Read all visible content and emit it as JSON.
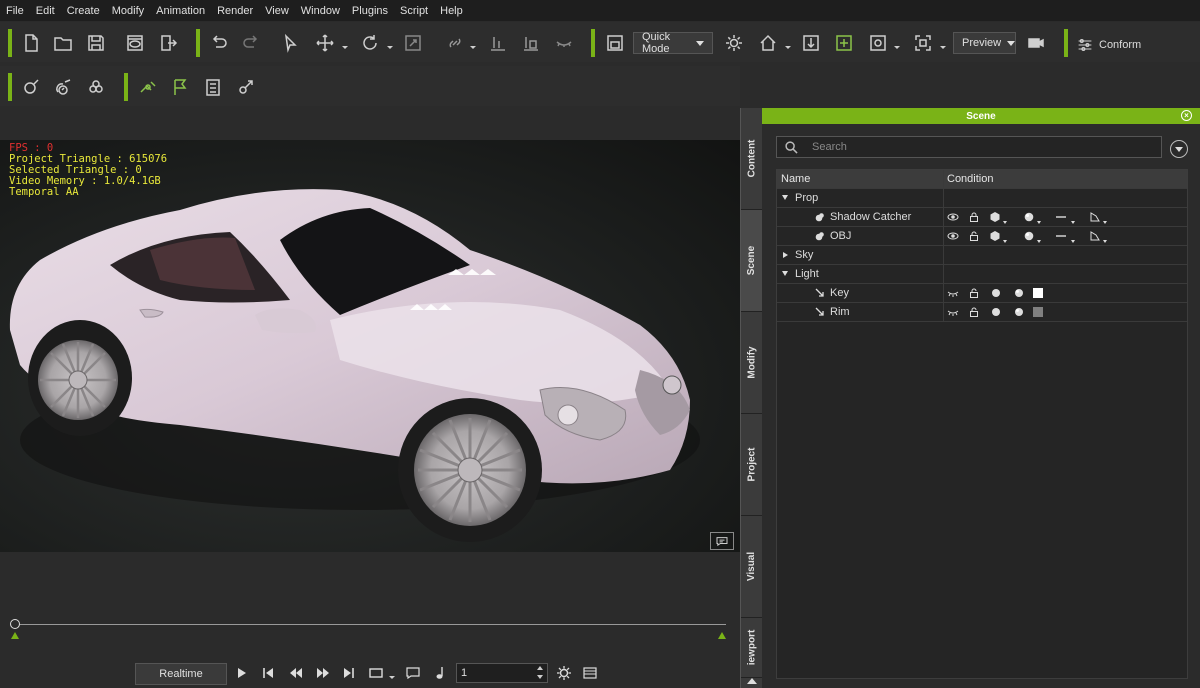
{
  "menu": [
    "File",
    "Edit",
    "Create",
    "Modify",
    "Animation",
    "Render",
    "View",
    "Window",
    "Plugins",
    "Script",
    "Help"
  ],
  "toolbar": {
    "quick_mode": "Quick Mode",
    "preview": "Preview",
    "conform": "Conform"
  },
  "hud": {
    "fps": "FPS : 0",
    "project_triangle": "Project Triangle : 615076",
    "selected_triangle": "Selected Triangle : 0",
    "video_memory": "Video Memory : 1.0/4.1GB",
    "temporal_aa": "Temporal AA"
  },
  "playback": {
    "mode": "Realtime",
    "frame": "1"
  },
  "side_tabs": [
    "Content",
    "Scene",
    "Modify",
    "Project",
    "Visual",
    "iewport"
  ],
  "scene_panel": {
    "title": "Scene",
    "search_placeholder": "Search",
    "columns": {
      "name": "Name",
      "condition": "Condition"
    },
    "rows": [
      {
        "label": "Prop",
        "level": 0,
        "expanded": true,
        "type": "group"
      },
      {
        "label": "Shadow Catcher",
        "level": 1,
        "type": "prop"
      },
      {
        "label": "OBJ",
        "level": 1,
        "type": "prop"
      },
      {
        "label": "Sky",
        "level": 0,
        "expanded": false,
        "type": "group"
      },
      {
        "label": "Light",
        "level": 0,
        "expanded": true,
        "type": "group"
      },
      {
        "label": "Key",
        "level": 1,
        "type": "light",
        "color": "#ffffff"
      },
      {
        "label": "Rim",
        "level": 1,
        "type": "light",
        "color": "#808080"
      }
    ]
  },
  "colors": {
    "accent": "#7ab317",
    "hud_text": "#e8e83a",
    "fps_text": "#e03030"
  }
}
